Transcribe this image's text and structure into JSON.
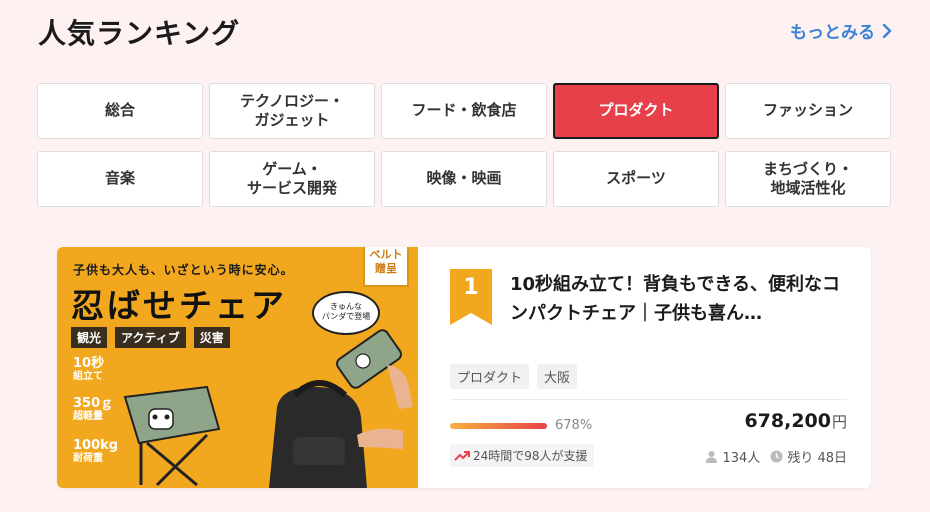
{
  "header": {
    "title": "人気ランキング",
    "see_more": "もっとみる"
  },
  "categories": [
    {
      "label": "総合",
      "active": false
    },
    {
      "label": "テクノロジー・\nガジェット",
      "active": false
    },
    {
      "label": "フード・飲食店",
      "active": false
    },
    {
      "label": "プロダクト",
      "active": true
    },
    {
      "label": "ファッション",
      "active": false
    },
    {
      "label": "音楽",
      "active": false
    },
    {
      "label": "ゲーム・\nサービス開発",
      "active": false
    },
    {
      "label": "映像・映画",
      "active": false
    },
    {
      "label": "スポーツ",
      "active": false
    },
    {
      "label": "まちづくり・\n地域活性化",
      "active": false
    }
  ],
  "project": {
    "rank": "1",
    "title": "10秒組み立て！背負もできる、便利なコンパクトチェア｜子供も喜ん…",
    "tags": [
      "プロダクト",
      "大阪"
    ],
    "progress_label": "678%",
    "progress_fraction": 1.0,
    "amount": "678,200",
    "amount_unit": "円",
    "support_text": "24時間で98人が支援",
    "backers": "134人",
    "remaining": "残り 48日",
    "banner": {
      "tagline": "子供も大人も、いざという時に安心。",
      "title": "忍ばせチェア",
      "tags": [
        "観光",
        "アクティブ",
        "災害"
      ],
      "spec1_main": "10秒",
      "spec1_sub": "組立て",
      "spec2_main": "350ｇ",
      "spec2_sub": "超軽量",
      "spec3_main": "100kg",
      "spec3_sub": "耐荷重",
      "belt": "ベルト\n贈呈",
      "bubble": "きゅんな\nパンダで登場"
    }
  },
  "colors": {
    "accent_red": "#e8404a",
    "link_blue": "#3b82d6",
    "rank_gold": "#f2a81e",
    "background": "#fdf1f1"
  }
}
